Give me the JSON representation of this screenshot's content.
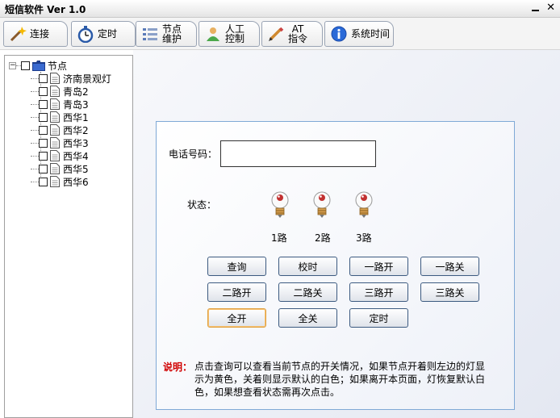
{
  "window": {
    "title": "短信软件 Ver 1.0",
    "close_glyph": "✕"
  },
  "toolbar": {
    "tabs": [
      {
        "label": "连接",
        "icon": "wand-icon"
      },
      {
        "label": "定时",
        "icon": "stopwatch-icon"
      },
      {
        "label": "节点\n维护",
        "icon": "list-icon"
      },
      {
        "label": "人工\n控制",
        "icon": "person-icon"
      },
      {
        "label": "AT\n指令",
        "icon": "pencil-icon"
      },
      {
        "label": "系统时间",
        "icon": "info-icon"
      }
    ]
  },
  "tree": {
    "root": {
      "label": "节点",
      "expander": "−"
    },
    "children": [
      "济南景观灯",
      "青岛2",
      "青岛3",
      "西华1",
      "西华2",
      "西华3",
      "西华4",
      "西华5",
      "西华6"
    ]
  },
  "form": {
    "phone_label": "电话号码：",
    "phone_value": "",
    "state_label": "状态：",
    "routes": [
      "1路",
      "2路",
      "3路"
    ]
  },
  "buttons": {
    "query": "查询",
    "calibrate": "校时",
    "r1_on": "一路开",
    "r1_off": "一路关",
    "r2_on": "二路开",
    "r2_off": "二路关",
    "r3_on": "三路开",
    "r3_off": "三路关",
    "all_on": "全开",
    "all_off": "全关",
    "timer": "定时"
  },
  "note": {
    "label": "说明：",
    "text": "点击查询可以查看当前节点的开关情况，如果节点开着则左边的灯显示为黄色，关着则显示默认的白色；如果离开本页面，灯恢复默认白色，如果想查看状态需再次点击。"
  },
  "colors": {
    "accent_border": "#7fa9d6",
    "note_label": "#d00000"
  }
}
